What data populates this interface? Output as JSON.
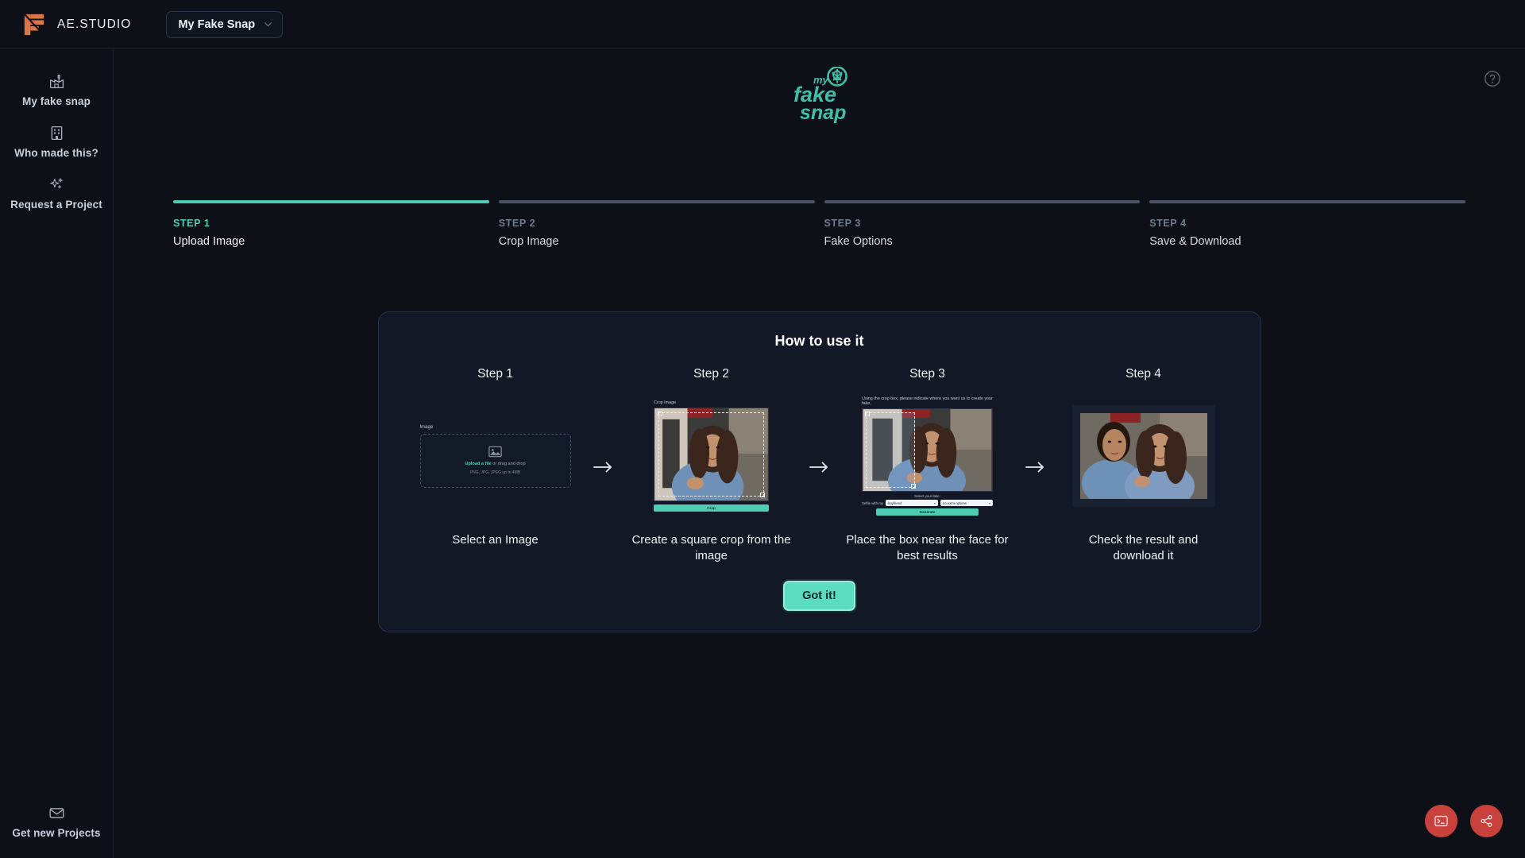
{
  "topbar": {
    "brand_name": "AE.STUDIO",
    "brand_logo_icon": "ae-studio-logo",
    "project_selector": {
      "value": "My Fake Snap",
      "chevron_icon": "chevron-down-icon"
    }
  },
  "sidebar": {
    "items": [
      {
        "label": "My fake snap",
        "icon": "factory-icon"
      },
      {
        "label": "Who made this?",
        "icon": "building-icon"
      },
      {
        "label": "Request a Project",
        "icon": "sparkles-icon"
      }
    ],
    "bottom_item": {
      "label": "Get new Projects",
      "icon": "envelope-icon"
    }
  },
  "main": {
    "help_icon": "question-circle-icon",
    "logo": {
      "icon": "my-fake-snap-logo",
      "line1": "my",
      "line2": "fake",
      "line3": "snap",
      "color": "#3fbfa8"
    }
  },
  "stepper": {
    "active_index": 0,
    "active_color": "#4ecdb4",
    "inactive_color": "#4a5263",
    "steps": [
      {
        "number": "STEP 1",
        "name": "Upload Image"
      },
      {
        "number": "STEP 2",
        "name": "Crop Image"
      },
      {
        "number": "STEP 3",
        "name": "Fake Options"
      },
      {
        "number": "STEP 4",
        "name": "Save & Download"
      }
    ]
  },
  "howto": {
    "title": "How to use it",
    "arrow_icon": "arrow-right-icon",
    "confirm_button": "Got it!",
    "steps": [
      {
        "title": "Step 1",
        "caption": "Select an Image",
        "mock": {
          "type": "upload",
          "field_label": "Image",
          "image_icon": "image-placeholder-icon",
          "link_text": "Upload a file",
          "rest_text": " or drag and drop",
          "hint_text": "PNG, JPG, JPEG up to 4MB"
        }
      },
      {
        "title": "Step 2",
        "caption": "Create a square crop from the image",
        "mock": {
          "type": "crop",
          "field_label": "Crop Image",
          "button_label": "Crop"
        }
      },
      {
        "title": "Step 3",
        "caption": "Place the box near the face for best results",
        "mock": {
          "type": "options",
          "instruction": "Using the crop box, please indicate where you want us to create your fake.",
          "section_label": "Select your fake:",
          "prefix_label": "Selfie with my",
          "select1_value": "boyfriend",
          "select2_value": "no extra options",
          "button_label": "Generate"
        }
      },
      {
        "title": "Step 4",
        "caption": "Check the result and download it",
        "mock": {
          "type": "result"
        }
      }
    ]
  },
  "fabs": [
    {
      "icon": "terminal-icon",
      "color": "#c8413d"
    },
    {
      "icon": "share-icon",
      "color": "#c8413d"
    }
  ]
}
